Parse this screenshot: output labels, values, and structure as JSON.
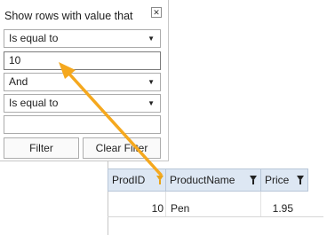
{
  "popup": {
    "title": "Show rows with value that",
    "close_glyph": "✕",
    "operator1": "Is equal to",
    "value1": "10",
    "logic": "And",
    "operator2": "Is equal to",
    "value2": "",
    "filter_label": "Filter",
    "clear_label": "Clear Filter"
  },
  "grid": {
    "columns": [
      {
        "label": "ProdID",
        "filter_active": true
      },
      {
        "label": "ProductName",
        "filter_active": false
      },
      {
        "label": "Price",
        "filter_active": false
      }
    ],
    "rows": [
      {
        "prodid": "10",
        "productname": "Pen",
        "price": "1.95"
      }
    ]
  },
  "colors": {
    "arrow": "#f5a81e",
    "active_filter_icon": "#e8a317",
    "header_bg": "#dde7f3"
  },
  "icons": {
    "dropdown": "chevron-down-icon",
    "column_filter": "funnel-icon"
  }
}
